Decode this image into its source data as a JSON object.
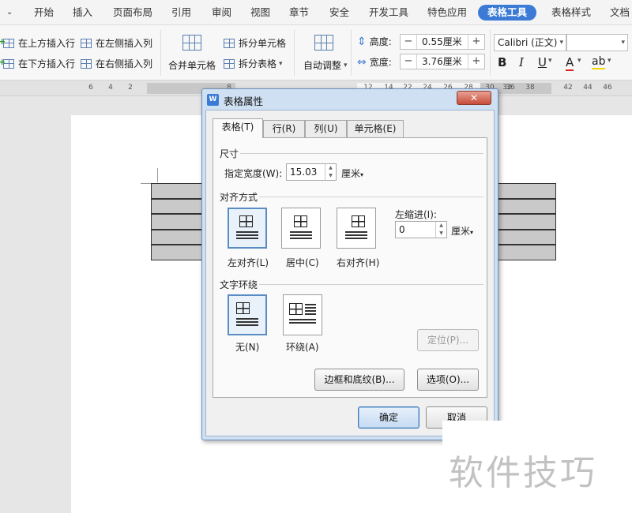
{
  "menu": {
    "items": [
      {
        "label": "开始",
        "active": false
      },
      {
        "label": "插入",
        "active": false
      },
      {
        "label": "页面布局",
        "active": false
      },
      {
        "label": "引用",
        "active": false
      },
      {
        "label": "审阅",
        "active": false
      },
      {
        "label": "视图",
        "active": false
      },
      {
        "label": "章节",
        "active": false
      },
      {
        "label": "安全",
        "active": false
      },
      {
        "label": "开发工具",
        "active": false
      },
      {
        "label": "特色应用",
        "active": false
      },
      {
        "label": "表格工具",
        "active": true
      },
      {
        "label": "表格样式",
        "active": false
      },
      {
        "label": "文档",
        "active": false
      }
    ],
    "accent_color": "#3b7bd6"
  },
  "ribbon": {
    "insert_above": "在上方插入行",
    "insert_below": "在下方插入行",
    "insert_left": "在左侧插入列",
    "insert_right": "在右侧插入列",
    "merge_cells": "合并单元格",
    "split_cells": "拆分单元格",
    "split_table": "拆分表格",
    "auto_fit": "自动调整",
    "height_label": "高度:",
    "height_value": "0.55厘米",
    "width_label": "宽度:",
    "width_value": "3.76厘米",
    "font_name": "Calibri (正文)",
    "font_size": "",
    "bold": "B",
    "italic": "I",
    "underline": "U",
    "font_color": "A",
    "highlight": "ab"
  },
  "ruler": {
    "labels": [
      "6",
      "4",
      "2",
      "8",
      "12",
      "14",
      "22",
      "24",
      "26",
      "28",
      "30",
      "32",
      "36",
      "38",
      "42",
      "44",
      "46"
    ]
  },
  "dialog": {
    "title": "表格属性",
    "close": "✕",
    "tabs": [
      "表格(T)",
      "行(R)",
      "列(U)",
      "单元格(E)"
    ],
    "size_group": "尺寸",
    "width_label": "指定宽度(W):",
    "width_value": "15.03",
    "width_unit": "厘米",
    "align_group": "对齐方式",
    "align_left": "左对齐(L)",
    "align_center": "居中(C)",
    "align_right": "右对齐(H)",
    "indent_label": "左缩进(I):",
    "indent_value": "0",
    "indent_unit": "厘米",
    "wrap_group": "文字环绕",
    "wrap_none": "无(N)",
    "wrap_around": "环绕(A)",
    "position_button": "定位(P)...",
    "borders_button": "边框和底纹(B)...",
    "options_button": "选项(O)...",
    "ok_button": "确定",
    "cancel_button": "取消"
  },
  "watermark": "软件技巧"
}
